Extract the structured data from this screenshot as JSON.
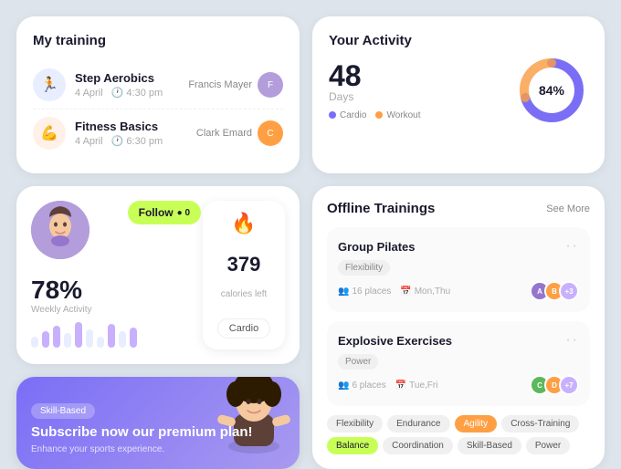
{
  "myTraining": {
    "title": "My training",
    "items": [
      {
        "name": "Step Aerobics",
        "date": "4 April",
        "time": "4:30 pm",
        "trainer": "Francis Mayer",
        "iconColor": "blue",
        "icon": "🏃"
      },
      {
        "name": "Fitness Basics",
        "date": "4 April",
        "time": "6:30 pm",
        "trainer": "Clark Emard",
        "iconColor": "orange",
        "icon": "💪"
      }
    ]
  },
  "yourActivity": {
    "title": "Your Activity",
    "days": "48",
    "daysLabel": "Days",
    "percent": 84,
    "percentLabel": "84%",
    "legend": {
      "cardio": "Cardio",
      "workout": "Workout"
    }
  },
  "profile": {
    "weeklyActivity": "78%",
    "weeklyLabel": "Weekly Activity",
    "followLabel": "Follow",
    "followCount": "0",
    "calories": "379",
    "caloriesLabel": "calories left",
    "activityType": "Cardio",
    "bars": [
      3,
      5,
      8,
      6,
      10,
      7,
      4,
      9,
      6,
      8
    ]
  },
  "offlineTrainings": {
    "title": "Offline Trainings",
    "seeMore": "See More",
    "items": [
      {
        "name": "Group Pilates",
        "tag": "Flexibility",
        "places": "16 places",
        "schedule": "Mon,Thu",
        "extraAvatars": "+3"
      },
      {
        "name": "Explosive Exercises",
        "tag": "Power",
        "places": "6 places",
        "schedule": "Tue,Fri",
        "extraAvatars": "+7"
      }
    ],
    "tags": [
      {
        "label": "Flexibility",
        "type": "normal"
      },
      {
        "label": "Endurance",
        "type": "normal"
      },
      {
        "label": "Agility",
        "type": "highlight"
      },
      {
        "label": "Cross-Training",
        "type": "normal"
      },
      {
        "label": "Balance",
        "type": "highlight2"
      },
      {
        "label": "Coordination",
        "type": "normal"
      },
      {
        "label": "Skill-Based",
        "type": "normal"
      },
      {
        "label": "Power",
        "type": "normal"
      }
    ]
  },
  "subscribe": {
    "badge": "Skill-Based",
    "title": "Subscribe now our premium plan!",
    "subtitle": "Enhance your sports experience."
  }
}
